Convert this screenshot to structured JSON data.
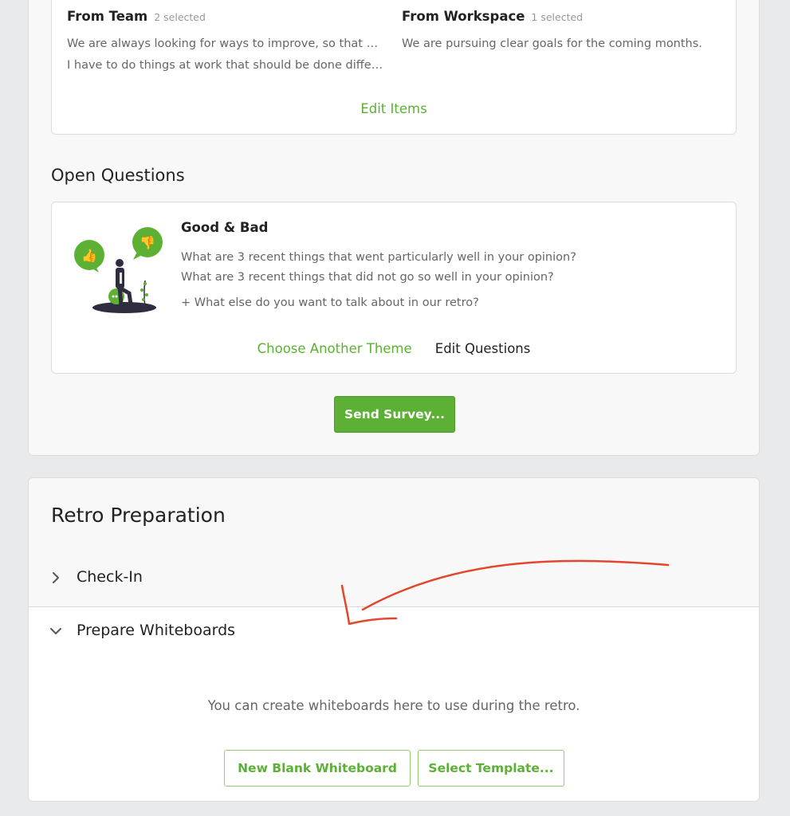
{
  "survey": {
    "items": {
      "team": {
        "title": "From Team",
        "count": "2 selected",
        "items": [
          "We are always looking for ways to improve, so that m…",
          "I have to do things at work that should be done differ…"
        ]
      },
      "workspace": {
        "title": "From Workspace",
        "count": "1 selected",
        "items": [
          "We are pursuing clear goals for the coming months."
        ]
      },
      "edit_label": "Edit Items"
    },
    "open_questions": {
      "heading": "Open Questions",
      "theme_title": "Good & Bad",
      "questions": [
        "What are 3 recent things that went particularly well in your opinion?",
        "What are 3 recent things that did not go so well in your opinion?"
      ],
      "extra_question": "+ What else do you want to talk about in our retro?",
      "choose_theme_label": "Choose Another Theme",
      "edit_questions_label": "Edit Questions"
    },
    "send_label": "Send Survey..."
  },
  "retro_preparation": {
    "heading": "Retro Preparation",
    "sections": {
      "checkin": {
        "label": "Check-In",
        "expanded": false
      },
      "whiteboards": {
        "label": "Prepare Whiteboards",
        "expanded": true,
        "description": "You can create whiteboards here to use during the retro.",
        "new_blank_label": "New Blank Whiteboard",
        "select_template_label": "Select Template..."
      }
    }
  },
  "colors": {
    "accent": "#5cb135",
    "annotation": "#e2472b",
    "page_bg": "#e9eaeb"
  }
}
